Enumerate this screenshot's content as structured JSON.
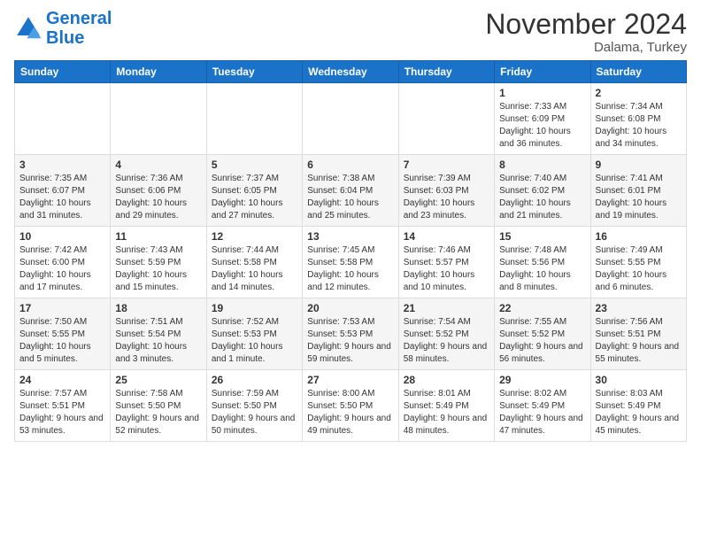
{
  "logo": {
    "line1": "General",
    "line2": "Blue"
  },
  "title": "November 2024",
  "location": "Dalama, Turkey",
  "days_of_week": [
    "Sunday",
    "Monday",
    "Tuesday",
    "Wednesday",
    "Thursday",
    "Friday",
    "Saturday"
  ],
  "weeks": [
    [
      {
        "day": "",
        "info": ""
      },
      {
        "day": "",
        "info": ""
      },
      {
        "day": "",
        "info": ""
      },
      {
        "day": "",
        "info": ""
      },
      {
        "day": "",
        "info": ""
      },
      {
        "day": "1",
        "info": "Sunrise: 7:33 AM\nSunset: 6:09 PM\nDaylight: 10 hours and 36 minutes."
      },
      {
        "day": "2",
        "info": "Sunrise: 7:34 AM\nSunset: 6:08 PM\nDaylight: 10 hours and 34 minutes."
      }
    ],
    [
      {
        "day": "3",
        "info": "Sunrise: 7:35 AM\nSunset: 6:07 PM\nDaylight: 10 hours and 31 minutes."
      },
      {
        "day": "4",
        "info": "Sunrise: 7:36 AM\nSunset: 6:06 PM\nDaylight: 10 hours and 29 minutes."
      },
      {
        "day": "5",
        "info": "Sunrise: 7:37 AM\nSunset: 6:05 PM\nDaylight: 10 hours and 27 minutes."
      },
      {
        "day": "6",
        "info": "Sunrise: 7:38 AM\nSunset: 6:04 PM\nDaylight: 10 hours and 25 minutes."
      },
      {
        "day": "7",
        "info": "Sunrise: 7:39 AM\nSunset: 6:03 PM\nDaylight: 10 hours and 23 minutes."
      },
      {
        "day": "8",
        "info": "Sunrise: 7:40 AM\nSunset: 6:02 PM\nDaylight: 10 hours and 21 minutes."
      },
      {
        "day": "9",
        "info": "Sunrise: 7:41 AM\nSunset: 6:01 PM\nDaylight: 10 hours and 19 minutes."
      }
    ],
    [
      {
        "day": "10",
        "info": "Sunrise: 7:42 AM\nSunset: 6:00 PM\nDaylight: 10 hours and 17 minutes."
      },
      {
        "day": "11",
        "info": "Sunrise: 7:43 AM\nSunset: 5:59 PM\nDaylight: 10 hours and 15 minutes."
      },
      {
        "day": "12",
        "info": "Sunrise: 7:44 AM\nSunset: 5:58 PM\nDaylight: 10 hours and 14 minutes."
      },
      {
        "day": "13",
        "info": "Sunrise: 7:45 AM\nSunset: 5:58 PM\nDaylight: 10 hours and 12 minutes."
      },
      {
        "day": "14",
        "info": "Sunrise: 7:46 AM\nSunset: 5:57 PM\nDaylight: 10 hours and 10 minutes."
      },
      {
        "day": "15",
        "info": "Sunrise: 7:48 AM\nSunset: 5:56 PM\nDaylight: 10 hours and 8 minutes."
      },
      {
        "day": "16",
        "info": "Sunrise: 7:49 AM\nSunset: 5:55 PM\nDaylight: 10 hours and 6 minutes."
      }
    ],
    [
      {
        "day": "17",
        "info": "Sunrise: 7:50 AM\nSunset: 5:55 PM\nDaylight: 10 hours and 5 minutes."
      },
      {
        "day": "18",
        "info": "Sunrise: 7:51 AM\nSunset: 5:54 PM\nDaylight: 10 hours and 3 minutes."
      },
      {
        "day": "19",
        "info": "Sunrise: 7:52 AM\nSunset: 5:53 PM\nDaylight: 10 hours and 1 minute."
      },
      {
        "day": "20",
        "info": "Sunrise: 7:53 AM\nSunset: 5:53 PM\nDaylight: 9 hours and 59 minutes."
      },
      {
        "day": "21",
        "info": "Sunrise: 7:54 AM\nSunset: 5:52 PM\nDaylight: 9 hours and 58 minutes."
      },
      {
        "day": "22",
        "info": "Sunrise: 7:55 AM\nSunset: 5:52 PM\nDaylight: 9 hours and 56 minutes."
      },
      {
        "day": "23",
        "info": "Sunrise: 7:56 AM\nSunset: 5:51 PM\nDaylight: 9 hours and 55 minutes."
      }
    ],
    [
      {
        "day": "24",
        "info": "Sunrise: 7:57 AM\nSunset: 5:51 PM\nDaylight: 9 hours and 53 minutes."
      },
      {
        "day": "25",
        "info": "Sunrise: 7:58 AM\nSunset: 5:50 PM\nDaylight: 9 hours and 52 minutes."
      },
      {
        "day": "26",
        "info": "Sunrise: 7:59 AM\nSunset: 5:50 PM\nDaylight: 9 hours and 50 minutes."
      },
      {
        "day": "27",
        "info": "Sunrise: 8:00 AM\nSunset: 5:50 PM\nDaylight: 9 hours and 49 minutes."
      },
      {
        "day": "28",
        "info": "Sunrise: 8:01 AM\nSunset: 5:49 PM\nDaylight: 9 hours and 48 minutes."
      },
      {
        "day": "29",
        "info": "Sunrise: 8:02 AM\nSunset: 5:49 PM\nDaylight: 9 hours and 47 minutes."
      },
      {
        "day": "30",
        "info": "Sunrise: 8:03 AM\nSunset: 5:49 PM\nDaylight: 9 hours and 45 minutes."
      }
    ]
  ]
}
